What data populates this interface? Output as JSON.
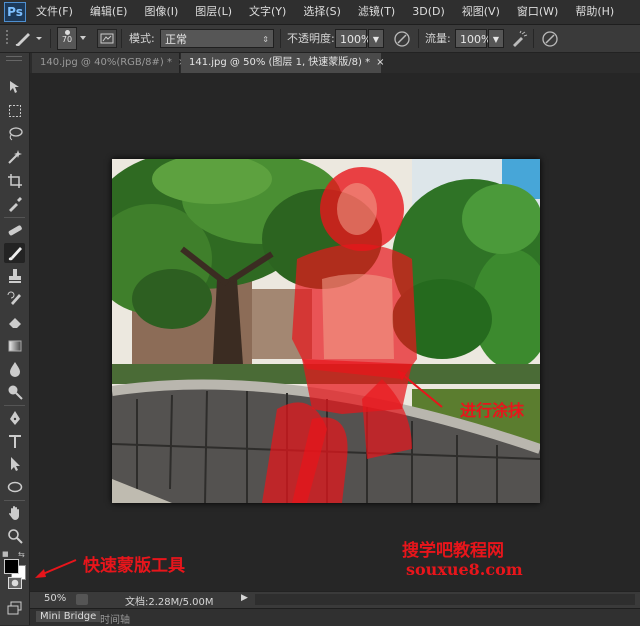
{
  "app": {
    "logo": "Ps"
  },
  "menu": [
    "文件(F)",
    "编辑(E)",
    "图像(I)",
    "图层(L)",
    "文字(Y)",
    "选择(S)",
    "滤镜(T)",
    "3D(D)",
    "视图(V)",
    "窗口(W)",
    "帮助(H)"
  ],
  "options": {
    "brush_size": "70",
    "mode_label": "模式:",
    "mode_value": "正常",
    "opacity_label": "不透明度:",
    "opacity_value": "100%",
    "flow_label": "流量:",
    "flow_value": "100%"
  },
  "tabs": [
    {
      "label": "140.jpg @ 40%(RGB/8#) *",
      "close": "×",
      "active": false
    },
    {
      "label": "141.jpg @ 50% (图层 1, 快速蒙版/8) *",
      "close": "×",
      "active": true
    }
  ],
  "status": {
    "zoom": "50%",
    "doc": "文档:2.28M/5.00M"
  },
  "panels": {
    "mini_bridge": "Mini Bridge",
    "timeline": "时间轴"
  },
  "annotations": {
    "smear": "进行涂抹",
    "quick_mask": "快速蒙版工具",
    "watermark_cn": "搜学吧教程网",
    "watermark_url": "souxue8.com"
  },
  "colors": {
    "mask_red": "#e8151b",
    "active_tab": "#4a4a4a",
    "ui_bg": "#2b2b2b"
  }
}
